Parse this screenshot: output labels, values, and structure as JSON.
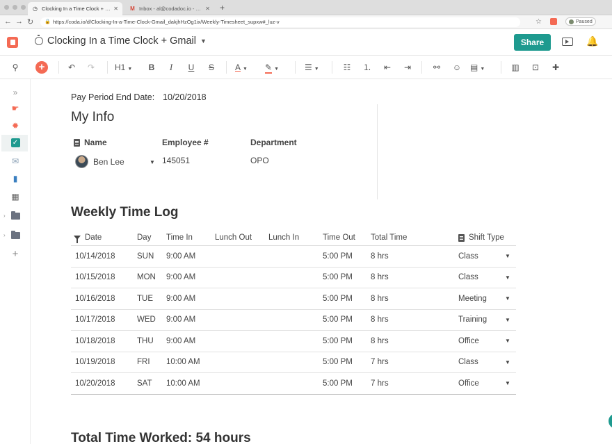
{
  "browser": {
    "tabs": [
      {
        "title": "Clocking In a Time Clock + Gm",
        "active": true
      },
      {
        "title": "Inbox - al@codadoc.io - Coda",
        "active": false
      }
    ],
    "url": "https://coda.io/d/Clocking-In-a-Time-Clock-Gmail_dakjhHzOg1ix/Weekly-Timesheet_supxw#_luz-v",
    "paused_label": "Paused"
  },
  "header": {
    "doc_title": "Clocking In a Time Clock + Gmail",
    "share_label": "Share",
    "accent_color": "#1e9a8f",
    "brand_color": "#f46a54"
  },
  "toolbar": {
    "heading_label": "H1",
    "bold": "B",
    "italic": "I",
    "underline": "U",
    "strike": "S",
    "text_color": "A"
  },
  "page": {
    "pay_period_label": "Pay Period End Date:",
    "pay_period_value": "10/20/2018",
    "my_info_heading": "My Info",
    "info_headers": {
      "name": "Name",
      "employee": "Employee #",
      "department": "Department"
    },
    "info_values": {
      "name": "Ben Lee",
      "employee": "145051",
      "department": "OPO"
    },
    "weekly_heading": "Weekly Time Log",
    "total_label": "Total Time Worked:  54  hours"
  },
  "table": {
    "columns": [
      "Date",
      "Day",
      "Time In",
      "Lunch Out",
      "Lunch In",
      "Time Out",
      "Total Time",
      "Shift Type"
    ],
    "rows": [
      {
        "date": "10/14/2018",
        "day": "SUN",
        "time_in": "9:00 AM",
        "lunch_out": "",
        "lunch_in": "",
        "time_out": "5:00 PM",
        "total": "8 hrs",
        "shift": "Class"
      },
      {
        "date": "10/15/2018",
        "day": "MON",
        "time_in": "9:00 AM",
        "lunch_out": "",
        "lunch_in": "",
        "time_out": "5:00 PM",
        "total": "8 hrs",
        "shift": "Class"
      },
      {
        "date": "10/16/2018",
        "day": "TUE",
        "time_in": "9:00 AM",
        "lunch_out": "",
        "lunch_in": "",
        "time_out": "5:00 PM",
        "total": "8 hrs",
        "shift": "Meeting"
      },
      {
        "date": "10/17/2018",
        "day": "WED",
        "time_in": "9:00 AM",
        "lunch_out": "",
        "lunch_in": "",
        "time_out": "5:00 PM",
        "total": "8 hrs",
        "shift": "Training"
      },
      {
        "date": "10/18/2018",
        "day": "THU",
        "time_in": "9:00 AM",
        "lunch_out": "",
        "lunch_in": "",
        "time_out": "5:00 PM",
        "total": "8 hrs",
        "shift": "Office"
      },
      {
        "date": "10/19/2018",
        "day": "FRI",
        "time_in": "10:00 AM",
        "lunch_out": "",
        "lunch_in": "",
        "time_out": "5:00 PM",
        "total": "7 hrs",
        "shift": "Class"
      },
      {
        "date": "10/20/2018",
        "day": "SAT",
        "time_in": "10:00 AM",
        "lunch_out": "",
        "lunch_in": "",
        "time_out": "5:00 PM",
        "total": "7 hrs",
        "shift": "Office"
      }
    ]
  }
}
